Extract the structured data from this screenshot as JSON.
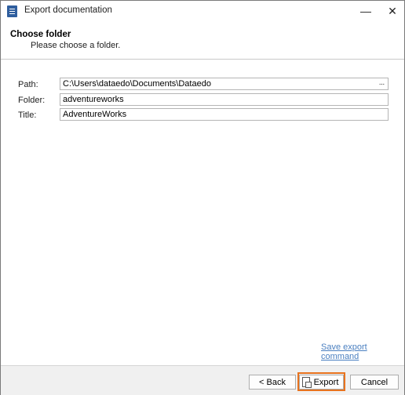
{
  "window": {
    "title": "Export documentation",
    "minimize_label": "—",
    "close_label": "✕"
  },
  "header": {
    "title": "Choose folder",
    "subtitle": "Please choose a folder."
  },
  "form": {
    "path_label": "Path:",
    "path_value": "C:\\Users\\dataedo\\Documents\\Dataedo",
    "browse_label": "···",
    "folder_label": "Folder:",
    "folder_value": "adventureworks",
    "title_label": "Title:",
    "title_value": "AdventureWorks"
  },
  "links": {
    "save_export_command": "Save export command"
  },
  "buttons": {
    "back": "< Back",
    "export": "Export",
    "cancel": "Cancel"
  },
  "colors": {
    "app_icon": "#2f5e9e",
    "link": "#4a7fc0",
    "export_highlight": "#e8731e"
  }
}
